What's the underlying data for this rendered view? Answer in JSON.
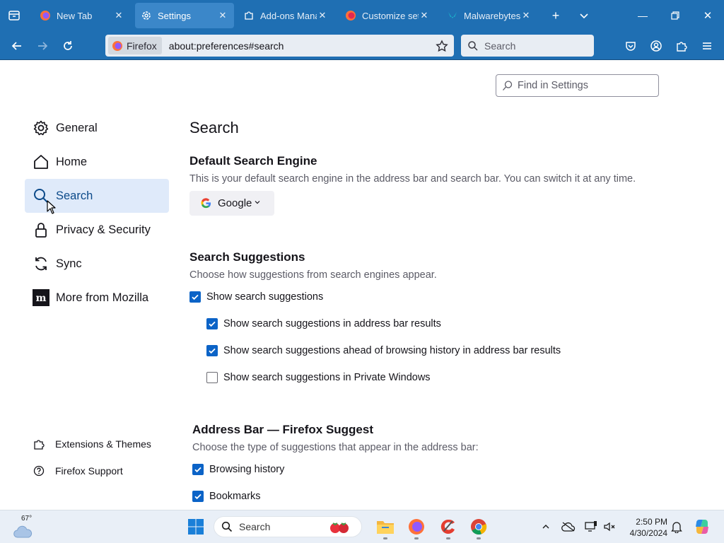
{
  "colors": {
    "chrome": "#1f6fb3",
    "accent": "#0b63c7",
    "selected_bg": "#dfeafa"
  },
  "tabs": [
    {
      "title": "New Tab",
      "icon": "firefox-icon",
      "active": false
    },
    {
      "title": "Settings",
      "icon": "gear-icon",
      "active": true
    },
    {
      "title": "Add-ons Manager",
      "icon": "puzzle-icon",
      "active": false
    },
    {
      "title": "Customize settings",
      "icon": "firefox-icon",
      "active": false
    },
    {
      "title": "Malwarebytes Browser Guard",
      "icon": "malwarebytes-icon",
      "active": false
    }
  ],
  "urlbar": {
    "identity_label": "Firefox",
    "url": "about:preferences#search"
  },
  "searchbar": {
    "placeholder": "Search"
  },
  "find": {
    "placeholder": "Find in Settings"
  },
  "categories": [
    {
      "label": "General",
      "icon": "gear-icon"
    },
    {
      "label": "Home",
      "icon": "home-icon"
    },
    {
      "label": "Search",
      "icon": "search-icon",
      "selected": true
    },
    {
      "label": "Privacy & Security",
      "icon": "lock-icon"
    },
    {
      "label": "Sync",
      "icon": "sync-icon"
    },
    {
      "label": "More from Mozilla",
      "icon": "mozilla-icon"
    }
  ],
  "footer_links": [
    {
      "label": "Extensions & Themes",
      "icon": "puzzle-icon"
    },
    {
      "label": "Firefox Support",
      "icon": "help-icon"
    }
  ],
  "main": {
    "title": "Search",
    "default_engine": {
      "heading": "Default Search Engine",
      "description": "This is your default search engine in the address bar and search bar. You can switch it at any time.",
      "selected": "Google"
    },
    "suggestions": {
      "heading": "Search Suggestions",
      "description": "Choose how suggestions from search engines appear.",
      "options": [
        {
          "label": "Show search suggestions",
          "checked": true
        },
        {
          "label": "Show search suggestions in address bar results",
          "checked": true
        },
        {
          "label": "Show search suggestions ahead of browsing history in address bar results",
          "checked": true
        },
        {
          "label": "Show search suggestions in Private Windows",
          "checked": false
        }
      ]
    },
    "address_bar": {
      "heading": "Address Bar — Firefox Suggest",
      "description": "Choose the type of suggestions that appear in the address bar:",
      "options": [
        {
          "label": "Browsing history",
          "checked": true
        },
        {
          "label": "Bookmarks",
          "checked": true
        }
      ]
    }
  },
  "taskbar": {
    "weather_temp": "67°",
    "search_placeholder": "Search",
    "time": "2:50 PM",
    "date": "4/30/2024"
  }
}
